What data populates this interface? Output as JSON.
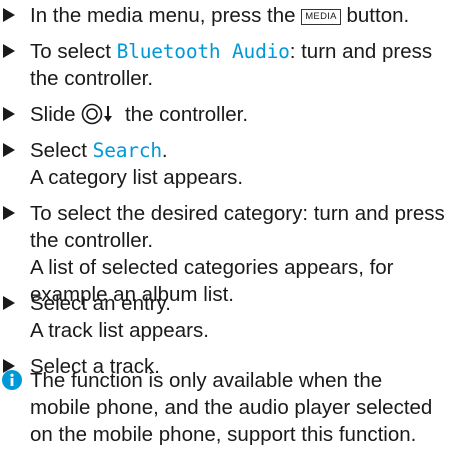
{
  "steps": [
    {
      "pre": "In the media menu, press the ",
      "key": "MEDIA",
      "post": " button."
    },
    {
      "pre": "To select ",
      "ui": "Bluetooth Audio",
      "post": ": turn and press",
      "line2": "the controller."
    },
    {
      "pre": "Slide ",
      "post": " the controller.",
      "control_icon": "controller-slide-down-icon"
    },
    {
      "pre": "Select ",
      "ui": "Search",
      "post": ".",
      "line2": "A category list appears."
    },
    {
      "line1": "To select the desired category: turn and press",
      "line2": "the controller.",
      "line3": "A list of selected categories appears, for",
      "line4": "example an album list."
    },
    {
      "line1": "Select an entry.",
      "line2": "A track list appears."
    },
    {
      "line1": "Select a track."
    }
  ],
  "note": {
    "icon": "info-icon",
    "line1": "The function is only available when the",
    "line2": "mobile phone, and the audio player selected",
    "line3": "on the mobile phone, support this function."
  },
  "colors": {
    "ui_text": "#0099d8",
    "info_icon": "#0099d8",
    "bullet": "#1a1a1a"
  }
}
